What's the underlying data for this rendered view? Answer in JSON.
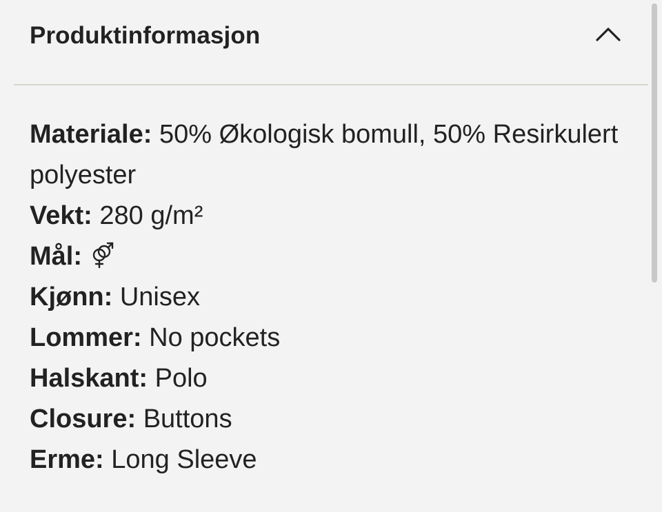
{
  "accordion": {
    "title": "Produktinformasjon",
    "toggle_icon": "chevron-up-icon",
    "expanded": true
  },
  "details": {
    "material": {
      "label": "Materiale:",
      "value": "50% Økologisk bomull, 50% Resirkulert polyester"
    },
    "weight": {
      "label": "Vekt:",
      "value": "280 g/m²"
    },
    "size": {
      "label": "Mål:",
      "icon": "gender-unisex-icon"
    },
    "gender": {
      "label": "Kjønn:",
      "value": "Unisex"
    },
    "pockets": {
      "label": "Lommer:",
      "value": "No pockets"
    },
    "neckline": {
      "label": "Halskant:",
      "value": "Polo"
    },
    "closure": {
      "label": "Closure:",
      "value": "Buttons"
    },
    "sleeve": {
      "label": "Erme:",
      "value": "Long Sleeve"
    }
  },
  "colors": {
    "background": "#f3f3f3",
    "text": "#222222",
    "divider": "#d4d4cf",
    "scrollbar_thumb": "#c8c8c8"
  }
}
